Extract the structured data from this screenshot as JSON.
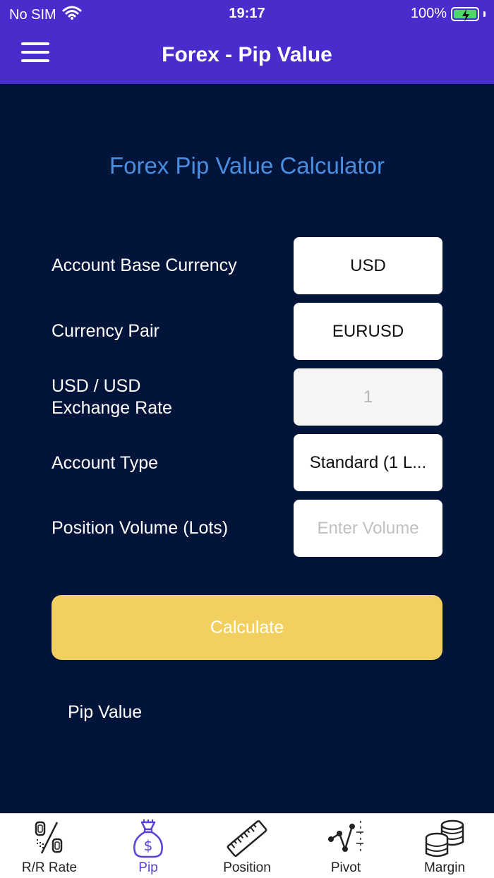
{
  "status_bar": {
    "carrier": "No SIM",
    "time": "19:17",
    "battery": "100%"
  },
  "nav": {
    "title": "Forex - Pip Value"
  },
  "calculator": {
    "title": "Forex Pip Value Calculator",
    "rows": [
      {
        "label": "Account Base Currency",
        "value": "USD"
      },
      {
        "label": "Currency Pair",
        "value": "EURUSD"
      },
      {
        "label_line1": "USD / USD",
        "label_line2": "Exchange Rate",
        "value": "1"
      },
      {
        "label": "Account Type",
        "value": "Standard (1 L..."
      },
      {
        "label": "Position Volume (Lots)",
        "placeholder": "Enter Volume",
        "value": ""
      }
    ],
    "calculate_label": "Calculate",
    "result_label": "Pip Value"
  },
  "tabs": [
    {
      "label": "R/R Rate",
      "icon": "percent-icon"
    },
    {
      "label": "Pip",
      "icon": "money-bag-icon",
      "active": true
    },
    {
      "label": "Position",
      "icon": "ruler-icon"
    },
    {
      "label": "Pivot",
      "icon": "pivot-chart-icon"
    },
    {
      "label": "Margin",
      "icon": "coins-stack-icon"
    }
  ],
  "colors": {
    "header": "#4a2bcb",
    "background": "#03143a",
    "accent_title": "#4a8ee0",
    "button": "#f2d060",
    "active_tab": "#5b3fd6"
  }
}
